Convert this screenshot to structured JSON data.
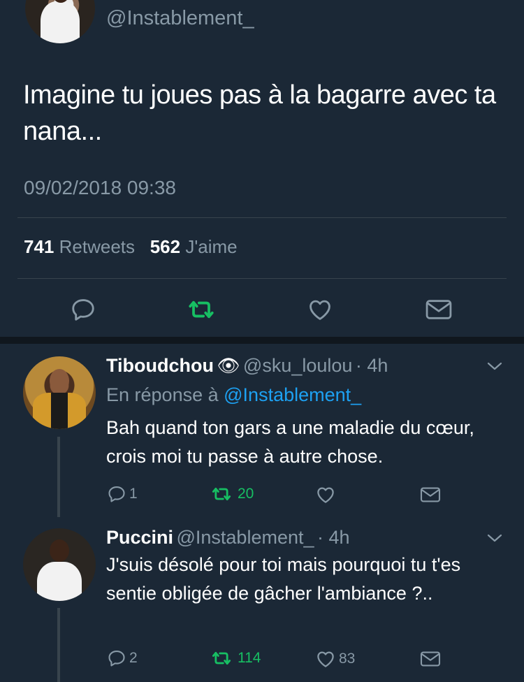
{
  "main_tweet": {
    "handle": "@Instablement_",
    "text": "Imagine tu joues pas à la bagarre avec ta nana...",
    "date": "09/02/2018 09:38",
    "retweets_count": "741",
    "retweets_label": "Retweets",
    "likes_count": "562",
    "likes_label": "J'aime"
  },
  "replies": [
    {
      "name": "Tiboudchou",
      "emoji": "👁",
      "handle": "@sku_loulou",
      "time": "· 4h",
      "reply_to_label": "En réponse à",
      "reply_to_handle": "@Instablement_",
      "text": "Bah quand ton gars a une maladie du cœur, crois moi tu passe à autre chose.",
      "reply_count": "1",
      "retweet_count": "20",
      "like_count": ""
    },
    {
      "name": "Puccini",
      "handle": "@Instablement_",
      "time": "· 4h",
      "text": "J'suis désolé pour toi mais pourquoi tu t'es sentie obligée de gâcher l'ambiance ?..",
      "reply_count": "2",
      "retweet_count": "114",
      "like_count": "83"
    }
  ],
  "colors": {
    "background": "#1b2836",
    "muted": "#8899a6",
    "retweet_active": "#17bf63",
    "link": "#1da1f2"
  },
  "icons": [
    "reply-icon",
    "retweet-icon",
    "like-icon",
    "message-icon",
    "chevron-down-icon"
  ]
}
